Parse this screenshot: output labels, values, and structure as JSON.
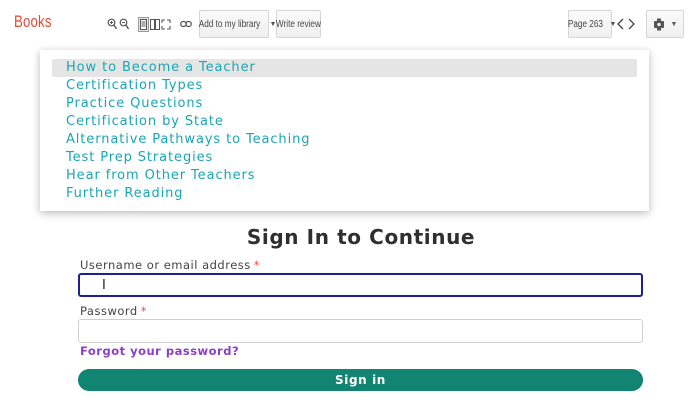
{
  "toolbar": {
    "brand": "Books",
    "add_to_library_label": "Add to my library",
    "write_review_label": "Write review",
    "page_label": "Page 263"
  },
  "toc": {
    "items": [
      "How to Become a Teacher",
      "Certification Types",
      "Practice Questions",
      "Certification by State",
      "Alternative Pathways to Teaching",
      "Test Prep Strategies",
      "Hear from Other Teachers",
      "Further Reading"
    ],
    "active_index": 0
  },
  "signin": {
    "heading": "Sign In to Continue",
    "username_label": "Username or email address",
    "password_label": "Password",
    "required_marker": "*",
    "username_value": "I",
    "password_value": "",
    "forgot_link": "Forgot your password?",
    "submit_label": "Sign in"
  },
  "colors": {
    "brand": "#dd4b39",
    "toc_link": "#1aa6b3",
    "forgot_link": "#8a3fc4",
    "button": "#128572",
    "focus_border": "#1f1f8f"
  }
}
